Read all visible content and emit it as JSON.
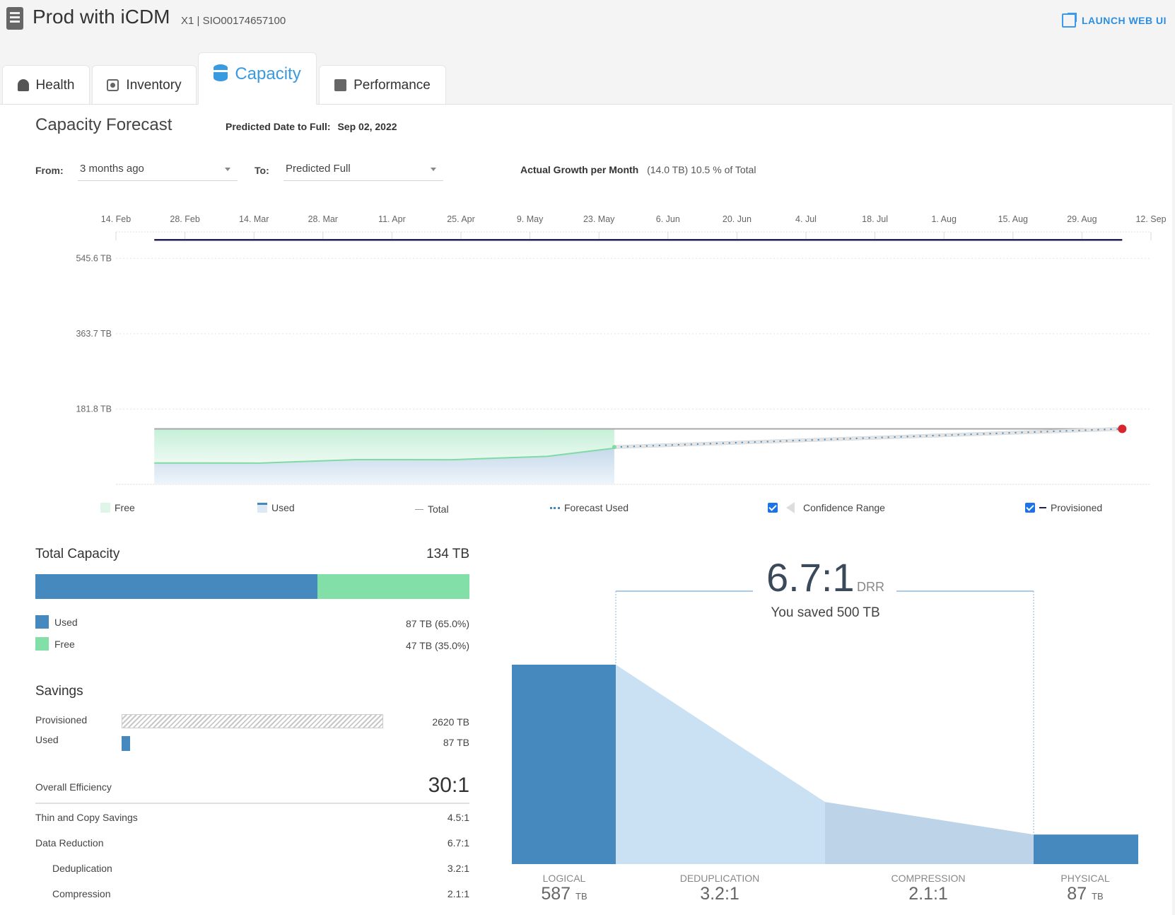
{
  "header": {
    "title": "Prod with iCDM",
    "model": "X1 | SIO00174657100",
    "launch_label": "LAUNCH WEB UI"
  },
  "tabs": [
    {
      "label": "Health",
      "icon": "bell-icon",
      "active": false
    },
    {
      "label": "Inventory",
      "icon": "gear-icon",
      "active": false
    },
    {
      "label": "Capacity",
      "icon": "database-icon",
      "active": true
    },
    {
      "label": "Performance",
      "icon": "bar-chart-icon",
      "active": false
    }
  ],
  "forecast": {
    "title": "Capacity Forecast",
    "predicted_label": "Predicted Date to Full:",
    "predicted_value": "Sep 02, 2022",
    "from_label": "From:",
    "from_value": "3 months ago",
    "to_label": "To:",
    "to_value": "Predicted Full",
    "growth_label": "Actual Growth per Month",
    "growth_value": "(14.0 TB) 10.5 % of Total"
  },
  "chart_data": {
    "type": "area",
    "title": "Capacity Forecast",
    "x_ticks": [
      "14. Feb",
      "28. Feb",
      "14. Mar",
      "28. Mar",
      "11. Apr",
      "25. Apr",
      "9. May",
      "23. May",
      "6. Jun",
      "20. Jun",
      "4. Jul",
      "18. Jul",
      "1. Aug",
      "15. Aug",
      "29. Aug",
      "12. Sep"
    ],
    "y_ticks": [
      "181.8 TB",
      "363.7 TB",
      "545.6 TB"
    ],
    "y_tick_values": [
      181.8,
      363.7,
      545.6
    ],
    "ylim": [
      0,
      640
    ],
    "xlim_days": [
      0,
      216
    ],
    "series": [
      {
        "name": "Total",
        "type": "line",
        "x_days": [
          8,
          104
        ],
        "y": [
          134,
          134
        ]
      },
      {
        "name": "Used",
        "type": "area",
        "x_days": [
          8,
          30,
          50,
          70,
          90,
          104
        ],
        "y": [
          50,
          54,
          58,
          62,
          66,
          90
        ]
      },
      {
        "name": "Free",
        "type": "area-between",
        "upper": "Total",
        "lower": "Used"
      },
      {
        "name": "Forecast Used",
        "type": "dotted",
        "x_days": [
          104,
          210
        ],
        "y": [
          90,
          134
        ]
      },
      {
        "name": "Provisioned",
        "type": "line",
        "x_days": [
          8,
          210
        ],
        "y": [
          590,
          590
        ]
      },
      {
        "name": "Confidence Range",
        "type": "band",
        "x_days": [
          104,
          210
        ],
        "lower": [
          86,
          130
        ],
        "upper": [
          94,
          138
        ]
      }
    ],
    "full_point": {
      "x_days": 210,
      "y": 134,
      "color": "#d9232e"
    },
    "legend": [
      {
        "label": "Free",
        "checkbox": false
      },
      {
        "label": "Used",
        "checkbox": false
      },
      {
        "label": "Total",
        "checkbox": false
      },
      {
        "label": "Forecast Used",
        "checkbox": false
      },
      {
        "label": "Confidence Range",
        "checkbox": true,
        "checked": true
      },
      {
        "label": "Provisioned",
        "checkbox": true,
        "checked": true
      }
    ],
    "legend_position": "bottom"
  },
  "total_capacity": {
    "title": "Total Capacity",
    "total": "134 TB",
    "used_fraction": 0.65,
    "used_label": "Used",
    "used_value": "87 TB (65.0%)",
    "free_label": "Free",
    "free_value": "47 TB (35.0%)"
  },
  "savings": {
    "title": "Savings",
    "provisioned_label": "Provisioned",
    "provisioned_value": "2620 TB",
    "used_label": "Used",
    "used_value": "87 TB",
    "overall_label": "Overall Efficiency",
    "overall_value": "30:1",
    "rows": [
      {
        "label": "Thin and Copy Savings",
        "value": "4.5:1",
        "indent": false
      },
      {
        "label": "Data Reduction",
        "value": "6.7:1",
        "indent": false
      },
      {
        "label": "Deduplication",
        "value": "3.2:1",
        "indent": true
      },
      {
        "label": "Compression",
        "value": "2.1:1",
        "indent": true
      }
    ]
  },
  "drr": {
    "ratio": "6.7:1",
    "unit": "DRR",
    "saved_text": "You saved 500 TB",
    "stages": [
      {
        "label": "LOGICAL",
        "value": "587",
        "unit": "TB"
      },
      {
        "label": "DEDUPLICATION",
        "value": "3.2:1",
        "unit": ""
      },
      {
        "label": "COMPRESSION",
        "value": "2.1:1",
        "unit": ""
      },
      {
        "label": "PHYSICAL",
        "value": "87",
        "unit": "TB"
      }
    ],
    "logical_tb": 587,
    "after_dedup_tb": 183,
    "physical_tb": 87
  },
  "colors": {
    "accent": "#3a9ae0",
    "used": "#4589bf",
    "free": "#82dfa8",
    "provisioned_line": "#1e2350",
    "full_marker": "#d9232e"
  }
}
